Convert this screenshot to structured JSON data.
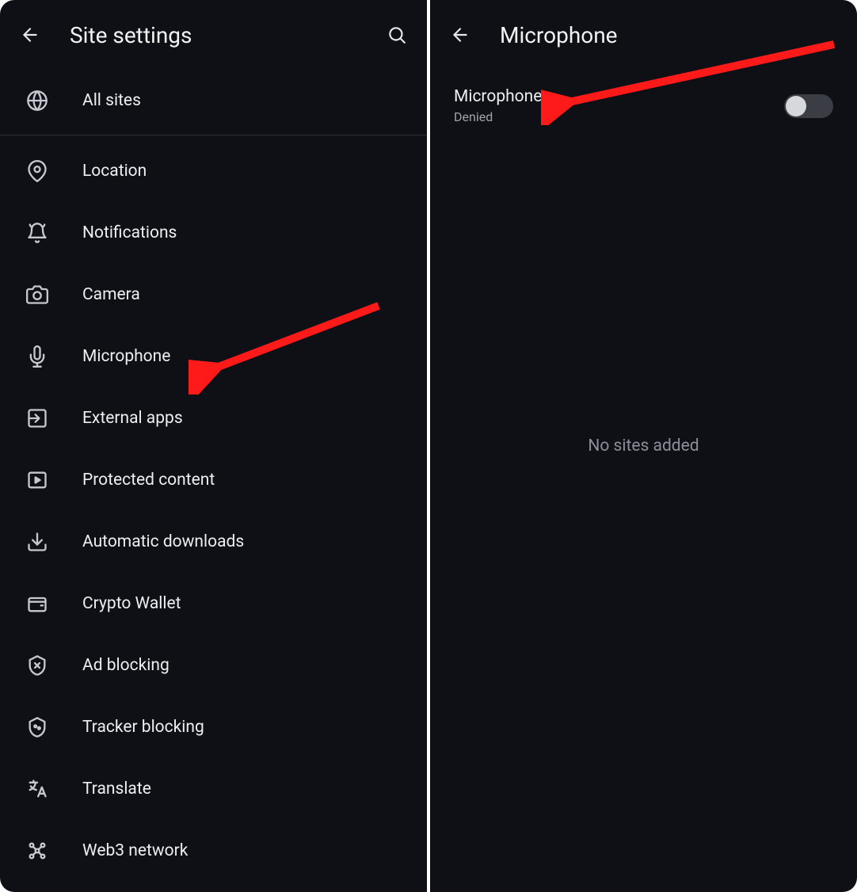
{
  "left": {
    "title": "Site settings",
    "allSites": "All sites",
    "items": [
      {
        "label": "Location"
      },
      {
        "label": "Notifications"
      },
      {
        "label": "Camera"
      },
      {
        "label": "Microphone"
      },
      {
        "label": "External apps"
      },
      {
        "label": "Protected content"
      },
      {
        "label": "Automatic downloads"
      },
      {
        "label": "Crypto Wallet"
      },
      {
        "label": "Ad blocking"
      },
      {
        "label": "Tracker blocking"
      },
      {
        "label": "Translate"
      },
      {
        "label": "Web3 network"
      }
    ]
  },
  "right": {
    "title": "Microphone",
    "setting": {
      "label": "Microphone",
      "status": "Denied",
      "enabled": false
    },
    "empty": "No sites added"
  }
}
